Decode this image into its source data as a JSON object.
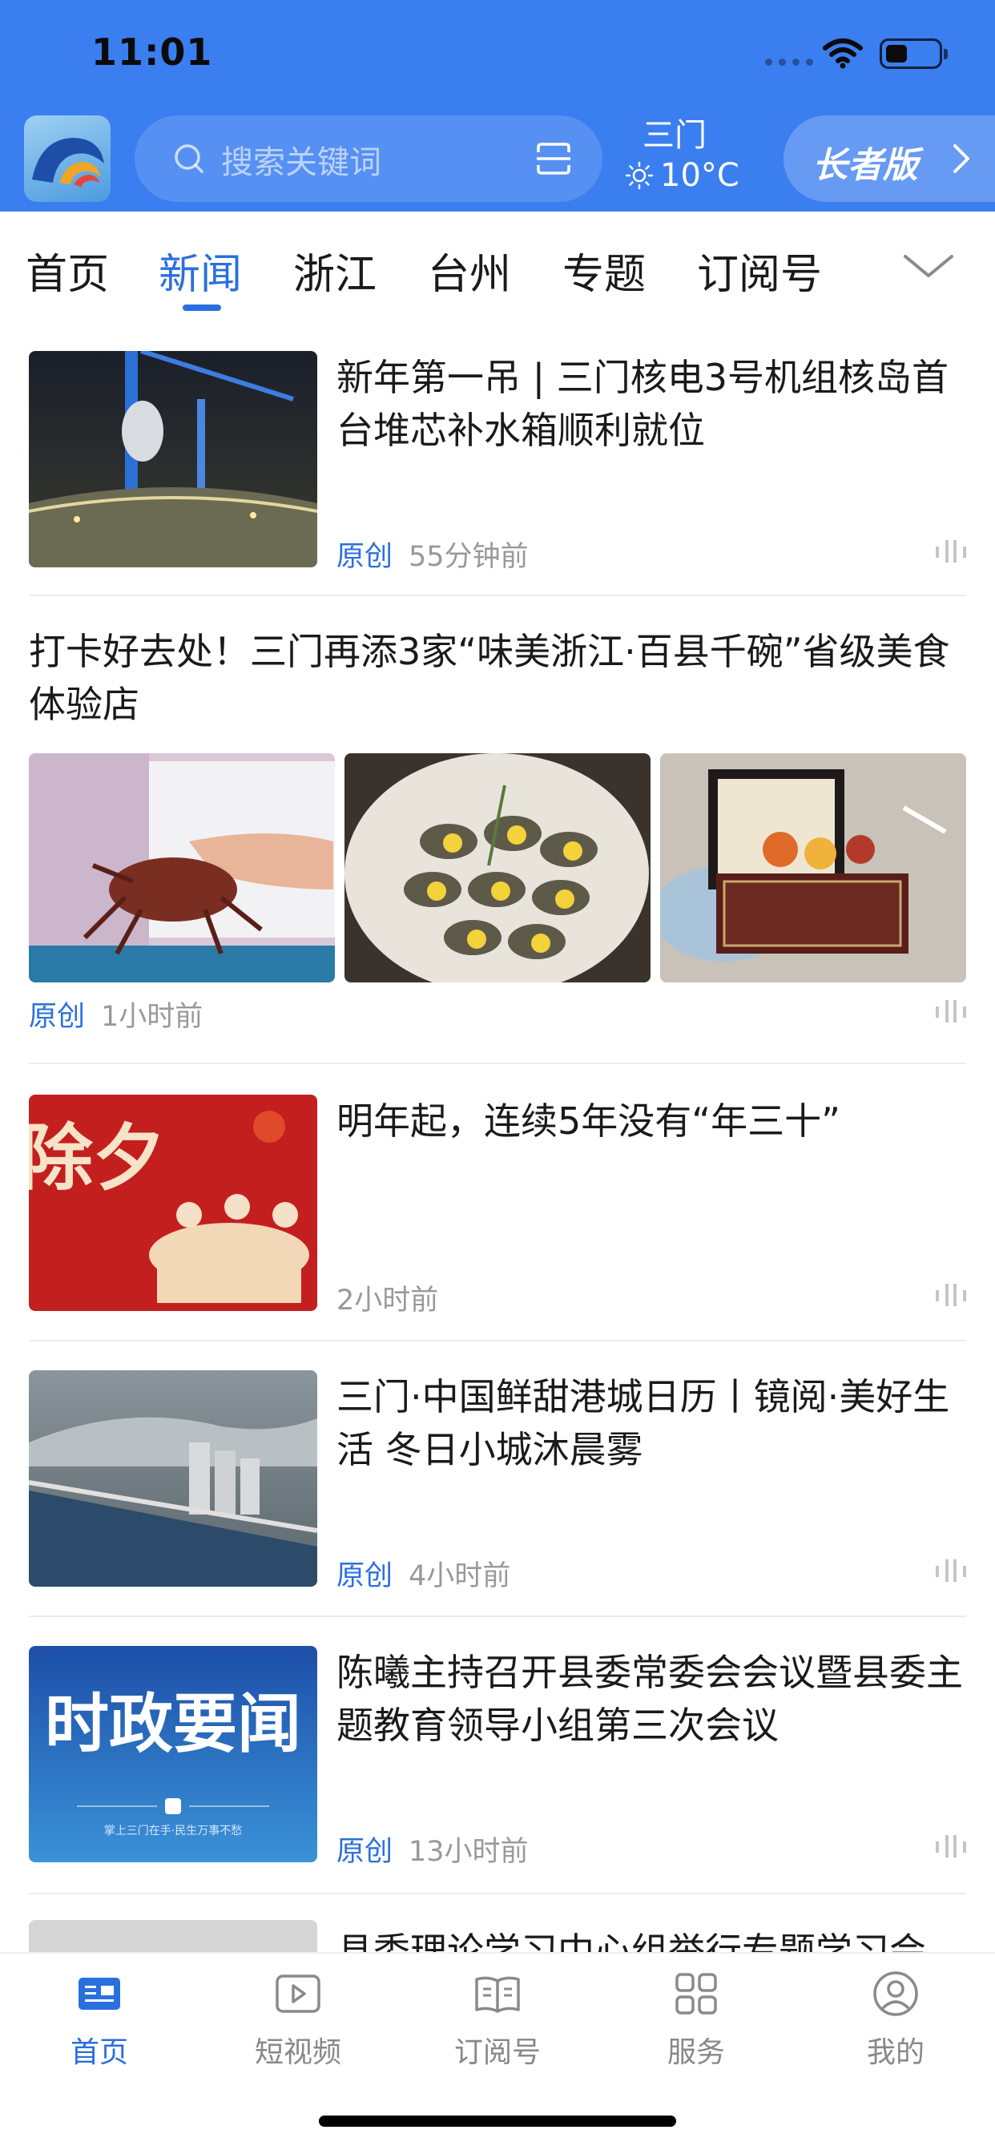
{
  "status_bar": {
    "time": "11:01"
  },
  "header": {
    "search_placeholder": "搜索关键词",
    "weather_city": "三门",
    "weather_temp": "10°C",
    "elder_mode_label": "长者版"
  },
  "tabs": [
    {
      "label": "首页",
      "active": false
    },
    {
      "label": "新闻",
      "active": true
    },
    {
      "label": "浙江",
      "active": false
    },
    {
      "label": "台州",
      "active": false
    },
    {
      "label": "专题",
      "active": false
    },
    {
      "label": "订阅号",
      "active": false
    }
  ],
  "articles": [
    {
      "title": "新年第一吊 | 三门核电3号机组核岛首台堆芯补水箱顺利就位",
      "tag": "原创",
      "time": "55分钟前"
    },
    {
      "title": "打卡好去处！三门再添3家“味美浙江·百县千碗”省级美食体验店",
      "tag": "原创",
      "time": "1小时前"
    },
    {
      "title": "明年起，连续5年没有“年三十”",
      "tag": "",
      "time": "2小时前",
      "image_text": "除夕"
    },
    {
      "title": "三门·中国鲜甜港城日历丨镜阅·美好生活 冬日小城沐晨雾",
      "tag": "原创",
      "time": "4小时前"
    },
    {
      "title": " 陈曦主持召开县委常委会会议暨县委主题教育领导小组第三次会议",
      "tag": "原创",
      "time": "13小时前",
      "image_text": "时政要闻",
      "image_subtext": "掌上三门在手·民生万事不愁"
    },
    {
      "title": " 县委理论学习中心组举行专题学习会"
    }
  ],
  "bottom_nav": [
    {
      "label": "首页",
      "icon": "news-icon",
      "active": true
    },
    {
      "label": "短视频",
      "icon": "video-icon",
      "active": false
    },
    {
      "label": "订阅号",
      "icon": "book-icon",
      "active": false
    },
    {
      "label": "服务",
      "icon": "grid-icon",
      "active": false
    },
    {
      "label": "我的",
      "icon": "user-icon",
      "active": false
    }
  ],
  "colors": {
    "header_blue": "#3b7ef0",
    "accent_blue": "#2a6fde",
    "meta_gray": "#999999"
  }
}
